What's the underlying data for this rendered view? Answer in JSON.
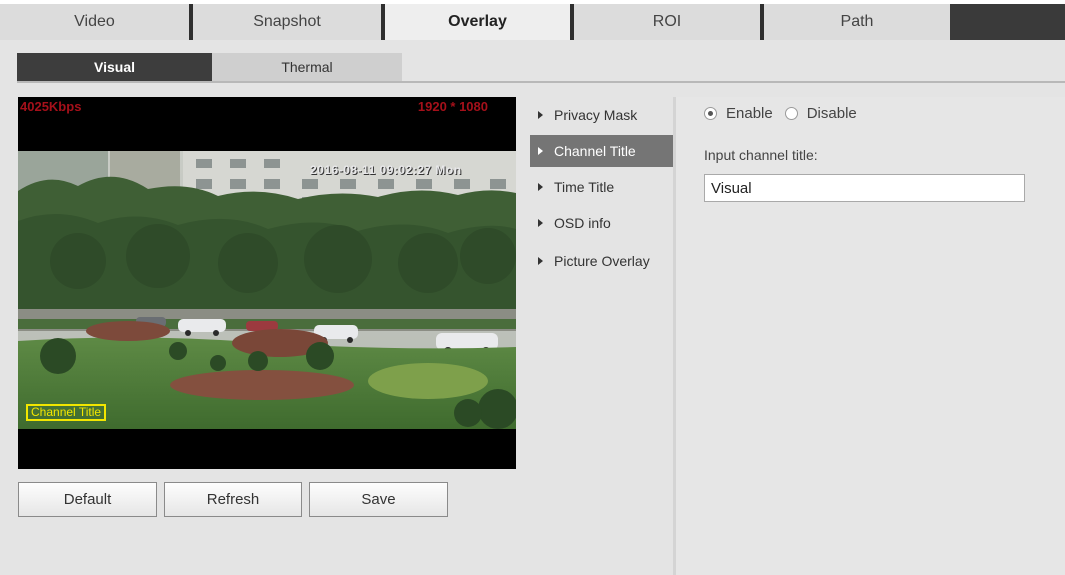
{
  "top_tabs": [
    "Video",
    "Snapshot",
    "Overlay",
    "ROI",
    "Path"
  ],
  "active_top_tab": "Overlay",
  "sub_tabs": [
    "Visual",
    "Thermal"
  ],
  "active_sub_tab": "Visual",
  "preview": {
    "bitrate": "4025Kbps",
    "resolution": "1920 * 1080",
    "time_osd": "2016-08-11 09:02:27 Mon",
    "channel_title_osd": "Channel Title"
  },
  "buttons": {
    "default": "Default",
    "refresh": "Refresh",
    "save": "Save"
  },
  "side_menu": [
    "Privacy Mask",
    "Channel Title",
    "Time Title",
    "OSD info",
    "Picture Overlay"
  ],
  "active_menu": "Channel Title",
  "channel_title": {
    "enable_label": "Enable",
    "disable_label": "Disable",
    "enabled": true,
    "input_label": "Input channel title:",
    "input_value": "Visual"
  },
  "colors": {
    "active_tab_bg": "#3d3d3d",
    "menu_active_bg": "#757575",
    "osd_red": "#a5101a",
    "osd_yellow": "#f2e600"
  }
}
